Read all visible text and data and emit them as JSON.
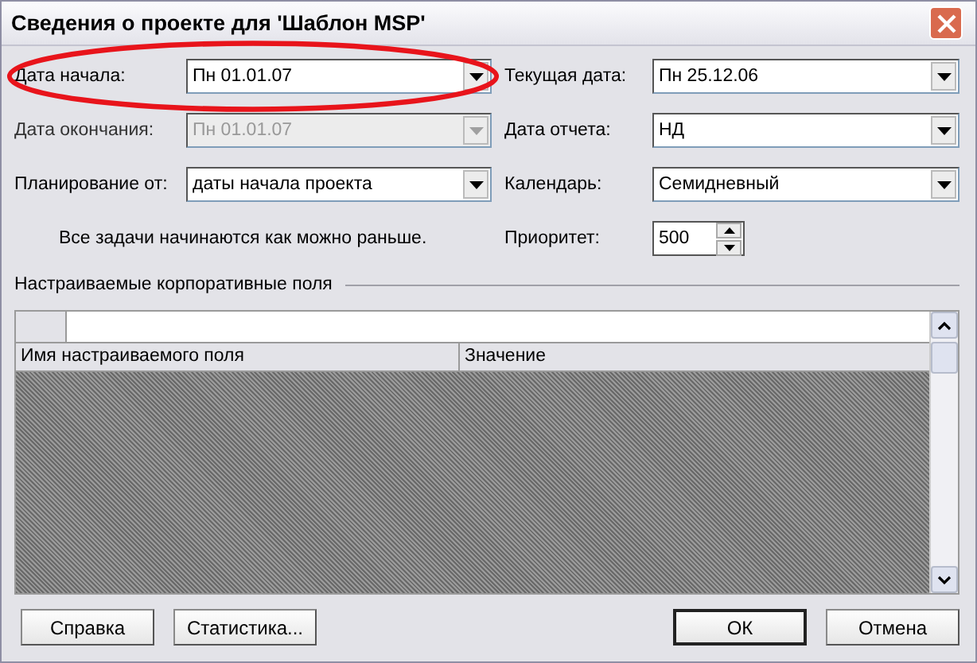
{
  "window": {
    "title": "Сведения о проекте для 'Шаблон MSP'"
  },
  "left_fields": [
    {
      "label": "Дата начала:",
      "value": "Пн 01.01.07",
      "disabled": false,
      "highlighted": true
    },
    {
      "label": "Дата окончания:",
      "value": "Пн 01.01.07",
      "disabled": true,
      "highlighted": false
    },
    {
      "label": "Планирование от:",
      "value": "даты начала проекта",
      "disabled": false,
      "highlighted": false
    }
  ],
  "right_fields": [
    {
      "label": "Текущая дата:",
      "value": "Пн 25.12.06",
      "disabled": false
    },
    {
      "label": "Дата отчета:",
      "value": "НД",
      "disabled": false
    },
    {
      "label": "Календарь:",
      "value": "Семидневный",
      "disabled": false
    }
  ],
  "note": "Все задачи начинаются как можно раньше.",
  "priority": {
    "label": "Приоритет:",
    "value": "500"
  },
  "custom_fields": {
    "title": "Настраиваемые корпоративные поля",
    "columns": [
      "Имя настраиваемого поля",
      "Значение"
    ]
  },
  "buttons": [
    {
      "label": "Справка",
      "default": false
    },
    {
      "label": "Статистика...",
      "default": false
    },
    {
      "label": "ОК",
      "default": true
    },
    {
      "label": "Отмена",
      "default": false
    }
  ]
}
